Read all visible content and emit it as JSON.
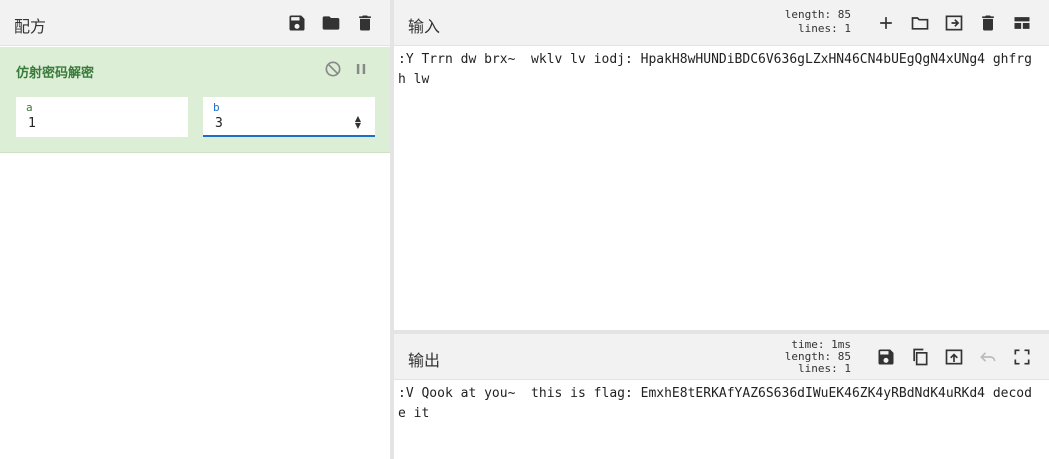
{
  "recipe": {
    "title": "配方",
    "operation": {
      "name": "仿射密码解密",
      "args": [
        {
          "label": "a",
          "value": "1"
        },
        {
          "label": "b",
          "value": "3"
        }
      ]
    }
  },
  "input": {
    "title": "输入",
    "length_label": "length:",
    "length_value": "85",
    "lines_label": "lines:",
    "lines_value": "1",
    "text": ":Y Trrn dw brx~  wklv lv iodj: HpakH8wHUNDiBDC6V636gLZxHN46CN4bUEgQgN4xUNg4 ghfrgh lw"
  },
  "output": {
    "title": "输出",
    "time_label": "time:",
    "time_value": "1ms",
    "length_label": "length:",
    "length_value": "85",
    "lines_label": "lines:",
    "lines_value": "1",
    "text": ":V Qook at you~  this is flag: EmxhE8tERKAfYAZ6S636dIWuEK46ZK4yRBdNdK4uRKd4 decode it"
  },
  "colors": {
    "op_bg": "#dcefd6",
    "op_title": "#3a7a3a",
    "arg_a_label": "#3a7a3a",
    "arg_b_label": "#1a6fc9"
  },
  "icons": [
    "save-icon",
    "folder-icon",
    "trash-icon",
    "plus-icon",
    "open-folder-icon",
    "import-icon",
    "layout-icon",
    "copy-icon",
    "upload-icon",
    "undo-icon",
    "maximize-icon",
    "disable-icon",
    "pause-icon"
  ]
}
